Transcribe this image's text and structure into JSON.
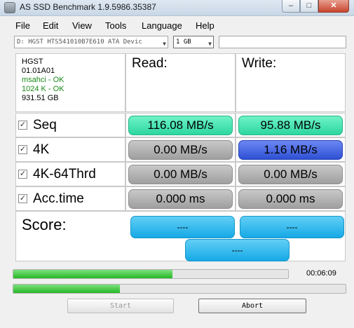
{
  "window": {
    "title": "AS SSD Benchmark 1.9.5986.35387",
    "controls": {
      "minimize": "–",
      "maximize": "□",
      "close": "✕"
    }
  },
  "menu": [
    "File",
    "Edit",
    "View",
    "Tools",
    "Language",
    "Help"
  ],
  "drive_select": {
    "value": "D: HGST HTS541010B7E610 ATA Devic",
    "arrow": "▼"
  },
  "size_select": {
    "value": "1 GB",
    "arrow": "▼"
  },
  "drive_info": {
    "vendor": "HGST",
    "firmware": "01.01A01",
    "driver": "msahci - OK",
    "alignment": "1024 K - OK",
    "capacity": "931.51 GB"
  },
  "columns": {
    "read": "Read:",
    "write": "Write:"
  },
  "rows": [
    {
      "label": "Seq",
      "checked": "✓",
      "read": "116.08 MB/s",
      "write": "95.88 MB/s"
    },
    {
      "label": "4K",
      "checked": "✓",
      "read": "0.00 MB/s",
      "write": "1.16 MB/s"
    },
    {
      "label": "4K-64Thrd",
      "checked": "✓",
      "read": "0.00 MB/s",
      "write": "0.00 MB/s"
    },
    {
      "label": "Acc.time",
      "checked": "✓",
      "read": "0.000 ms",
      "write": "0.000 ms"
    }
  ],
  "score": {
    "label": "Score:",
    "read": "----",
    "write": "----",
    "total": "----"
  },
  "progress": {
    "test_fraction": 0.58,
    "total_fraction": 0.32,
    "elapsed": "00:06:09"
  },
  "buttons": {
    "start": "Start",
    "abort": "Abort"
  },
  "colors": {
    "ok_text": "#1a8a1a",
    "done_result": "#2cd6a0",
    "active_result": "#2e50d3",
    "pending_result": "#9f9f9f",
    "score": "#16a9e6",
    "progress": "#25b825"
  }
}
